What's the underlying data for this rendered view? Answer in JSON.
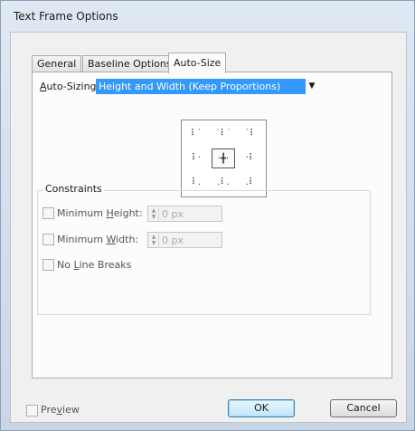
{
  "dialog": {
    "title": "Text Frame Options"
  },
  "tabs": [
    {
      "label": "General"
    },
    {
      "label": "Baseline Options"
    },
    {
      "label": "Auto-Size"
    }
  ],
  "auto_sizing": {
    "label_prefix": "A",
    "label_rest": "uto-Sizing",
    "value": "Height and Width (Keep Proportions)"
  },
  "reference_grid": {
    "glyphs": [
      "⠇˙",
      "˙⠇˙",
      "˙⠇",
      "⠇·",
      "·╋·",
      "·⠇",
      "⠇.",
      ".⠇.",
      ".⠇"
    ],
    "selected_index": 4
  },
  "constraints": {
    "title": "Constraints",
    "min_height": {
      "label_prefix": "Minimum ",
      "accel": "H",
      "label_rest": "eight:",
      "value": "0 px",
      "checked": false
    },
    "min_width": {
      "label_prefix": "Minimum ",
      "accel": "W",
      "label_rest": "idth:",
      "value": "0 px",
      "checked": false
    },
    "no_line_breaks": {
      "label_prefix": "No ",
      "accel": "L",
      "label_rest": "ine Breaks",
      "checked": false
    }
  },
  "footer": {
    "preview_prefix": "Pre",
    "preview_accel": "v",
    "preview_rest": "iew",
    "ok_label": "OK",
    "cancel_label": "Cancel"
  }
}
